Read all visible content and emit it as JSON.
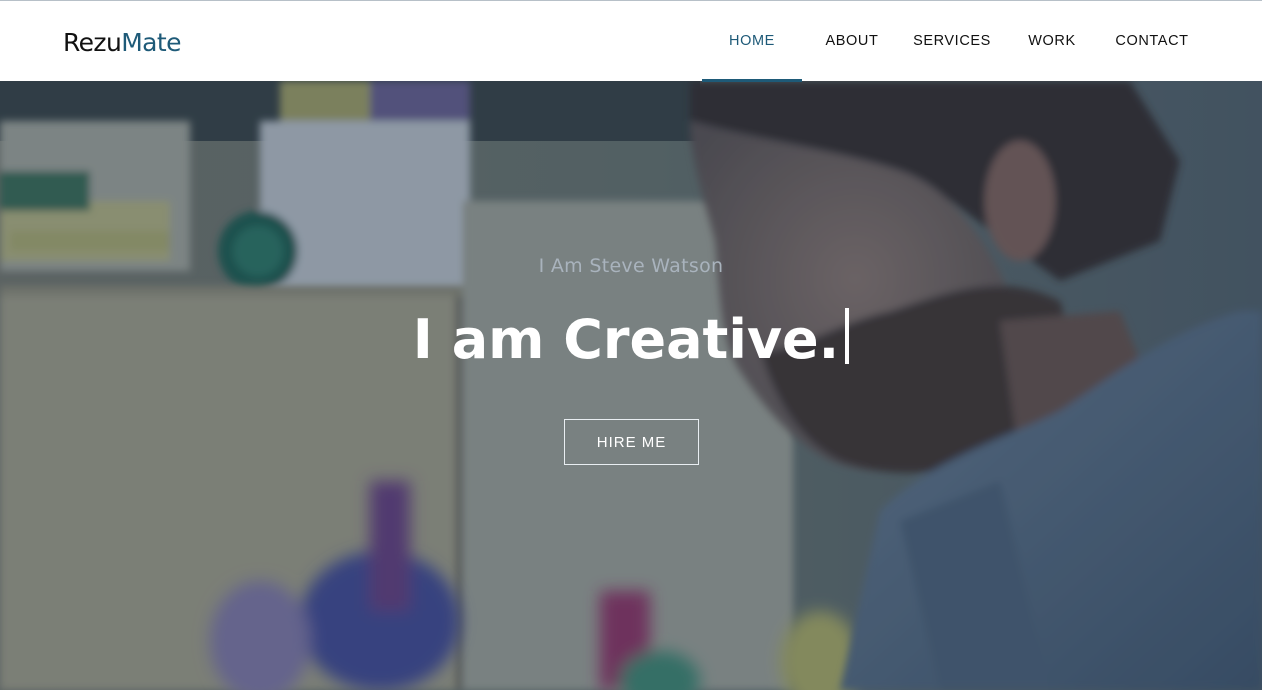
{
  "brand": {
    "part1": "Rezu",
    "part2": "Mate",
    "accent_color": "#1e5a78"
  },
  "nav": {
    "items": [
      {
        "label": "HOME",
        "active": true
      },
      {
        "label": "ABOUT",
        "active": false
      },
      {
        "label": "SERVICES",
        "active": false
      },
      {
        "label": "WORK",
        "active": false
      },
      {
        "label": "CONTACT",
        "active": false
      }
    ]
  },
  "hero": {
    "subtitle": "I Am Steve Watson",
    "title": "I am Creative.",
    "cta_label": "HIRE ME",
    "overlay_color": "#20344e"
  }
}
